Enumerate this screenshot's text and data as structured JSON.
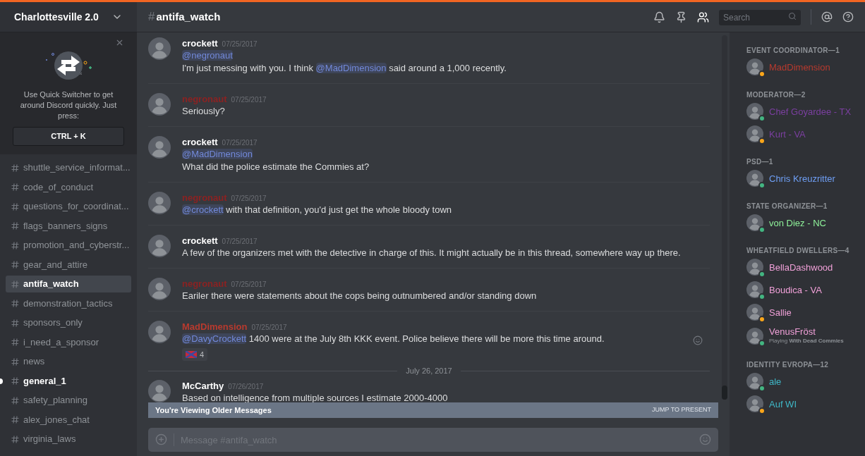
{
  "server": {
    "name": "Charlottesville 2.0"
  },
  "quick_switcher": {
    "text": "Use Quick Switcher to get around Discord quickly. Just press:",
    "shortcut": "CTRL + K"
  },
  "channels": [
    {
      "name": "shuttle_service_informat...",
      "selected": false,
      "unread": false
    },
    {
      "name": "code_of_conduct",
      "selected": false,
      "unread": false
    },
    {
      "name": "questions_for_coordinat...",
      "selected": false,
      "unread": false
    },
    {
      "name": "flags_banners_signs",
      "selected": false,
      "unread": false
    },
    {
      "name": "promotion_and_cyberstr...",
      "selected": false,
      "unread": false
    },
    {
      "name": "gear_and_attire",
      "selected": false,
      "unread": false
    },
    {
      "name": "antifa_watch",
      "selected": true,
      "unread": false
    },
    {
      "name": "demonstration_tactics",
      "selected": false,
      "unread": false
    },
    {
      "name": "sponsors_only",
      "selected": false,
      "unread": false
    },
    {
      "name": "i_need_a_sponsor",
      "selected": false,
      "unread": false
    },
    {
      "name": "news",
      "selected": false,
      "unread": false
    },
    {
      "name": "general_1",
      "selected": false,
      "unread": true
    },
    {
      "name": "safety_planning",
      "selected": false,
      "unread": false
    },
    {
      "name": "alex_jones_chat",
      "selected": false,
      "unread": false
    },
    {
      "name": "virginia_laws",
      "selected": false,
      "unread": false
    }
  ],
  "channel_header": {
    "hash": "#",
    "name": "antifa_watch",
    "search_placeholder": "Search"
  },
  "messages": [
    {
      "kind": "message",
      "author": "crockett",
      "color": "#ffffff",
      "date": "07/25/2017",
      "lines": [
        [
          {
            "kind": "mention",
            "text": "@negronaut"
          }
        ],
        [
          {
            "kind": "text",
            "text": "I'm just messing with you. I think "
          },
          {
            "kind": "mention",
            "text": "@MadDimension"
          },
          {
            "kind": "text",
            "text": "  said around a 1,000 recently."
          }
        ]
      ]
    },
    {
      "kind": "message",
      "author": "negronaut",
      "color": "#8b2222",
      "date": "07/25/2017",
      "lines": [
        [
          {
            "kind": "text",
            "text": "Seriously?"
          }
        ]
      ]
    },
    {
      "kind": "message",
      "author": "crockett",
      "color": "#ffffff",
      "date": "07/25/2017",
      "lines": [
        [
          {
            "kind": "mention",
            "text": "@MadDimension"
          }
        ],
        [
          {
            "kind": "text",
            "text": "What did the police estimate the Commies at?"
          }
        ]
      ]
    },
    {
      "kind": "message",
      "author": "negronaut",
      "color": "#8b2222",
      "date": "07/25/2017",
      "lines": [
        [
          {
            "kind": "mention",
            "text": "@crockett"
          },
          {
            "kind": "text",
            "text": " with that definition, you'd just get the whole bloody town"
          }
        ]
      ]
    },
    {
      "kind": "message",
      "author": "crockett",
      "color": "#ffffff",
      "date": "07/25/2017",
      "lines": [
        [
          {
            "kind": "text",
            "text": "A few of the organizers met with the detective in charge of this. It might actually be in this thread, somewhere way up there."
          }
        ]
      ]
    },
    {
      "kind": "message",
      "author": "negronaut",
      "color": "#8b2222",
      "date": "07/25/2017",
      "lines": [
        [
          {
            "kind": "text",
            "text": "Eariler there were statements about the cops being outnumbered and/or standing down"
          }
        ]
      ]
    },
    {
      "kind": "message",
      "author": "MadDimension",
      "color": "#b83a2e",
      "date": "07/25/2017",
      "lines": [
        [
          {
            "kind": "mention",
            "text": "@DavyCrockett"
          },
          {
            "kind": "text",
            "text": " 1400 were at the July 8th KKK event. Police believe there will be more this time around."
          }
        ]
      ],
      "reaction": {
        "count": "4"
      }
    },
    {
      "kind": "divider",
      "text": "July 26, 2017"
    },
    {
      "kind": "message",
      "author": "McCarthy",
      "color": "#ffffff",
      "date": "07/26/2017",
      "lines": [
        [
          {
            "kind": "text",
            "text": "Based on intelligence from multiple sources I estimate 2000-4000"
          }
        ]
      ]
    }
  ],
  "older_bar": {
    "text": "You're Viewing Older Messages",
    "action": "JUMP TO PRESENT"
  },
  "composer": {
    "placeholder": "Message #antifa_watch"
  },
  "member_groups": [
    {
      "title": "EVENT COORDINATOR—1",
      "members": [
        {
          "name": "MadDimension",
          "color": "#b83a2e",
          "idle": true
        }
      ]
    },
    {
      "title": "MODERATOR—2",
      "members": [
        {
          "name": "Chef Goyardee - TX",
          "color": "#7b3fa0",
          "idle": false
        },
        {
          "name": "Kurt - VA",
          "color": "#7b3fa0",
          "idle": true
        }
      ]
    },
    {
      "title": "PSD—1",
      "members": [
        {
          "name": "Chris Kreuzritter",
          "color": "#6f9ff5",
          "idle": false
        }
      ]
    },
    {
      "title": "STATE ORGANIZER—1",
      "members": [
        {
          "name": "von Diez - NC",
          "color": "#8ff29a",
          "idle": false
        }
      ]
    },
    {
      "title": "WHEATFIELD DWELLERS—4",
      "members": [
        {
          "name": "BellaDashwood",
          "color": "#f0a0d8",
          "idle": false
        },
        {
          "name": "Boudica - VA",
          "color": "#f0a0d8",
          "idle": false
        },
        {
          "name": "Sallie",
          "color": "#f0a0d8",
          "idle": true
        },
        {
          "name": "VenusFröst",
          "color": "#f0a0d8",
          "idle": false,
          "activity_prefix": "Playing",
          "activity": "With Dead Commies"
        }
      ]
    },
    {
      "title": "IDENTITY EVROPA—12",
      "members": [
        {
          "name": "ale",
          "color": "#3fb8c8",
          "idle": false
        },
        {
          "name": "Auf WI",
          "color": "#3fb8c8",
          "idle": true
        }
      ]
    }
  ]
}
